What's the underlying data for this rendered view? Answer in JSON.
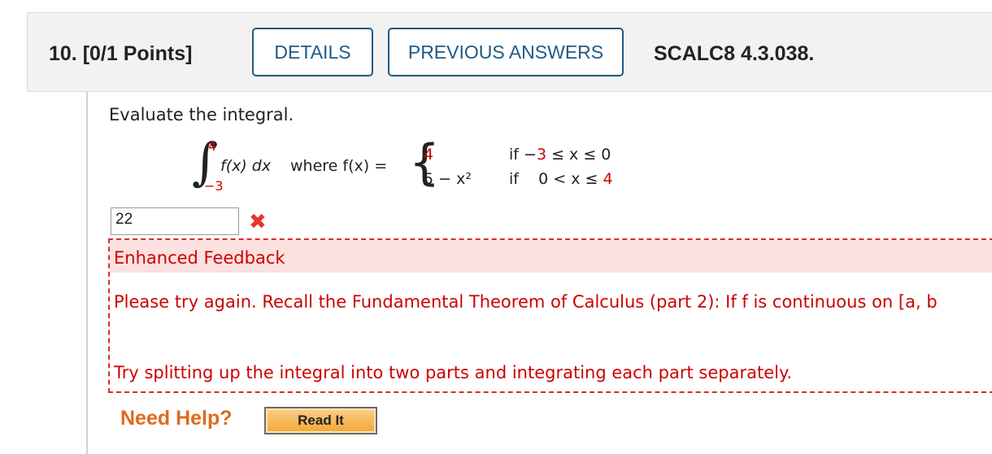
{
  "header": {
    "question_label": "10.  [0/1 Points]",
    "details_button": "DETAILS",
    "previous_answers_button": "PREVIOUS ANSWERS",
    "problem_code": "SCALC8 4.3.038."
  },
  "question": {
    "prompt": "Evaluate the integral.",
    "upper_limit": "4",
    "lower_limit": "−3",
    "integrand": "f(x) dx",
    "where_text": "where f(x)  =",
    "case1_value": "4",
    "case1_condition_prefix": "if  −",
    "case1_condition_num1": "3",
    "case1_condition_mid": " ≤ x ≤ 0",
    "case2_value": "5 − x²",
    "case2_condition_prefix": "if    0 < x ≤ ",
    "case2_condition_num": "4"
  },
  "answer": {
    "value": "22",
    "status_icon": "x-mark-icon",
    "status_color": "#e8352b"
  },
  "feedback": {
    "title": "Enhanced Feedback",
    "line1": "Please try again. Recall the Fundamental Theorem of Calculus (part 2): If f is continuous on  [a, b",
    "line2": "Try splitting up the integral into two parts and integrating each part separately."
  },
  "help": {
    "need_help_label": "Need Help?",
    "read_it_button": "Read It"
  },
  "colors": {
    "accent": "#1f5a84",
    "error": "#cc0000",
    "feedback_bg": "#fde0e0",
    "need_help": "#e06a1a"
  }
}
